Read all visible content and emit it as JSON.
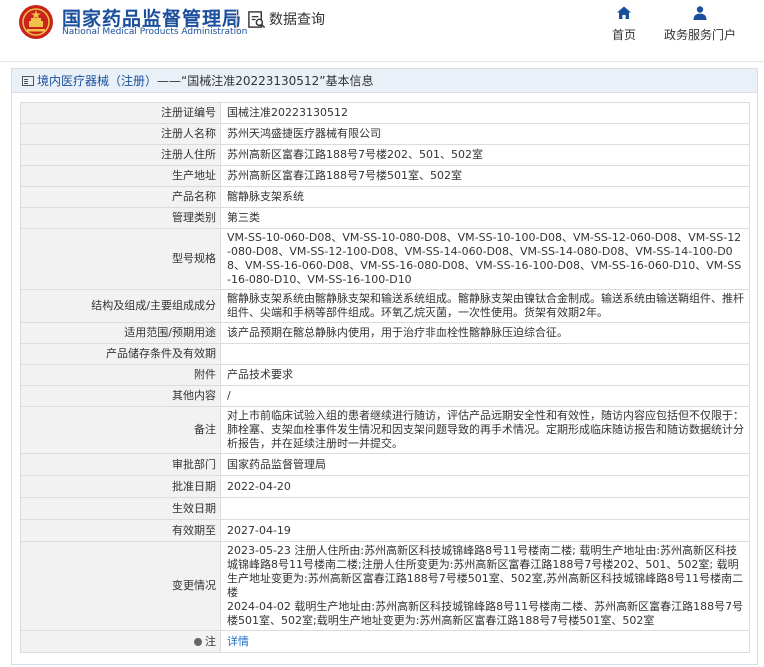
{
  "header": {
    "brand_cn": "国家药品监督管理局",
    "brand_en": "National Medical Products Administration",
    "query_label": "数据查询",
    "nav_home": "首页",
    "nav_gov": "政务服务门户"
  },
  "breadcrumb": {
    "prefix": "境内医疗器械（注册）",
    "sep": "——",
    "record": "“国械注准20223130512”",
    "suffix": "基本信息"
  },
  "rows": [
    {
      "label": "注册证编号",
      "value": "国械注准20223130512"
    },
    {
      "label": "注册人名称",
      "value": "苏州天鸿盛捷医疗器械有限公司"
    },
    {
      "label": "注册人住所",
      "value": "苏州高新区富春江路188号7号楼202、501、502室"
    },
    {
      "label": "生产地址",
      "value": "苏州高新区富春江路188号7号楼501室、502室"
    },
    {
      "label": "产品名称",
      "value": "髂静脉支架系统"
    },
    {
      "label": "管理类别",
      "value": "第三类"
    },
    {
      "label": "型号规格",
      "value": "VM-SS-10-060-D08、VM-SS-10-080-D08、VM-SS-10-100-D08、VM-SS-12-060-D08、VM-SS-12-080-D08、VM-SS-12-100-D08、VM-SS-14-060-D08、VM-SS-14-080-D08、VM-SS-14-100-D08、VM-SS-16-060-D08、VM-SS-16-080-D08、VM-SS-16-100-D08、VM-SS-16-060-D10、VM-SS-16-080-D10、VM-SS-16-100-D10"
    },
    {
      "label": "结构及组成/主要组成成分",
      "value": "髂静脉支架系统由髂静脉支架和输送系统组成。髂静脉支架由镍钛合金制成。输送系统由输送鞘组件、推杆组件、尖端和手柄等部件组成。环氧乙烷灭菌，一次性使用。货架有效期2年。"
    },
    {
      "label": "适用范围/预期用途",
      "value": "该产品预期在髂总静脉内使用，用于治疗非血栓性髂静脉压迫综合征。"
    },
    {
      "label": "产品储存条件及有效期",
      "value": ""
    },
    {
      "label": "附件",
      "value": "产品技术要求"
    },
    {
      "label": "其他内容",
      "value": "/"
    },
    {
      "label": "备注",
      "value": "对上市前临床试验入组的患者继续进行随访，评估产品远期安全性和有效性，随访内容应包括但不仅限于：肺栓塞、支架血栓事件发生情况和因支架问题导致的再手术情况。定期形成临床随访报告和随访数据统计分析报告，并在延续注册时一并提交。"
    },
    {
      "label": "审批部门",
      "value": "国家药品监督管理局"
    },
    {
      "label": "批准日期",
      "value": "2022-04-20"
    },
    {
      "label": "生效日期",
      "value": ""
    },
    {
      "label": "有效期至",
      "value": "2027-04-19"
    },
    {
      "label": "变更情况",
      "value_lines": [
        "2023-05-23 注册人住所由:苏州高新区科技城锦峰路8号11号楼南二楼; 载明生产地址由:苏州高新区科技城锦峰路8号11号楼南二楼;注册人住所变更为:苏州高新区富春江路188号7号楼202、501、502室; 载明生产地址变更为:苏州高新区富春江路188号7号楼501室、502室,苏州高新区科技城锦峰路8号11号楼南二楼",
        "2024-04-02 载明生产地址由:苏州高新区科技城锦峰路8号11号楼南二楼、苏州高新区富春江路188号7号楼501室、502室;载明生产地址变更为:苏州高新区富春江路188号7号楼501室、502室"
      ]
    },
    {
      "label": "注",
      "value": "详情"
    }
  ]
}
